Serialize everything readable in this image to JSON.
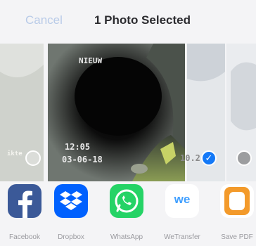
{
  "header": {
    "cancel_label": "Cancel",
    "title": "1 Photo Selected"
  },
  "photos": {
    "main_overlay": {
      "tag": "NIEUW",
      "time": "12:05",
      "date": "03-06-18",
      "temp": "10.2"
    },
    "left_overlay": "ikte"
  },
  "apps": [
    {
      "label": "Facebook",
      "icon": "facebook-icon",
      "color": "#3b5998"
    },
    {
      "label": "Dropbox",
      "icon": "dropbox-icon",
      "color": "#0061fe"
    },
    {
      "label": "WhatsApp",
      "icon": "whatsapp-icon",
      "color": "#25d366"
    },
    {
      "label": "WeTransfer",
      "icon": "wetransfer-icon",
      "color": "#409fff"
    },
    {
      "label": "Save PDF",
      "icon": "save-pdf-icon",
      "color": "#f39a2b"
    }
  ],
  "colors": {
    "accent": "#1479f7",
    "cancel_text": "#b9cbe8"
  }
}
